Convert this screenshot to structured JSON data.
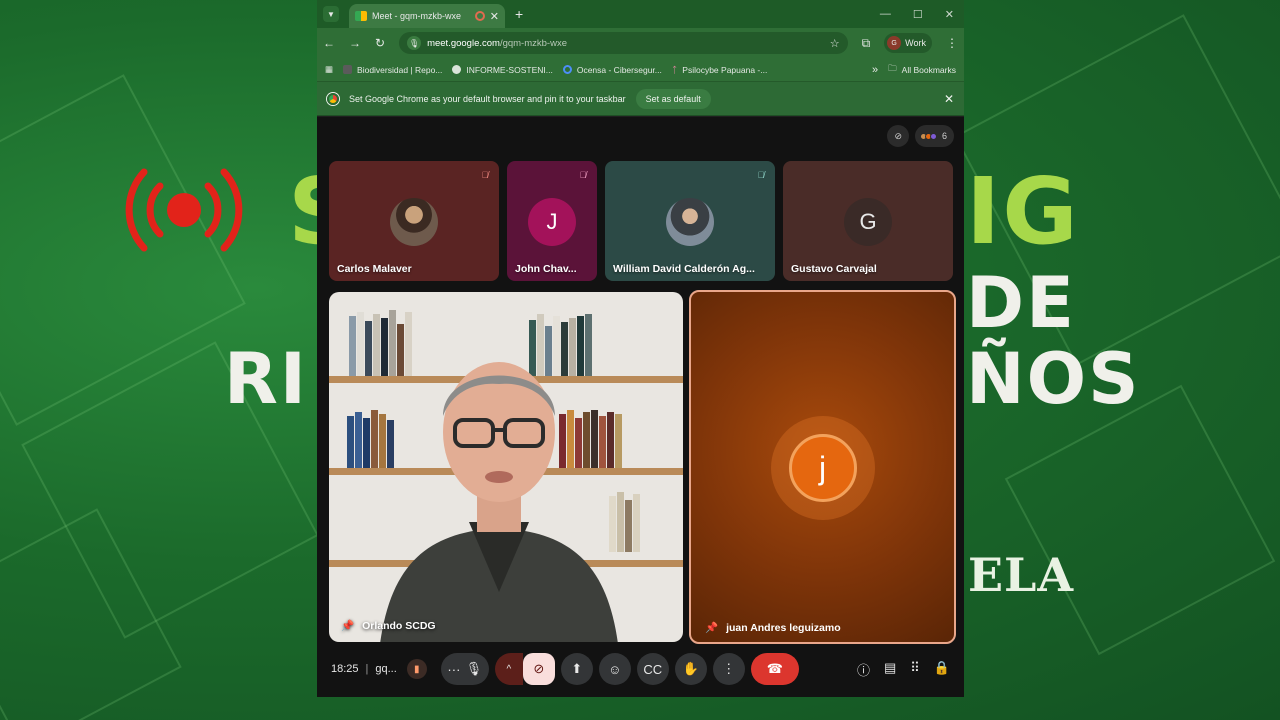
{
  "background": {
    "headline_fragments": [
      "S",
      "IG",
      "DE",
      "RI",
      "ÑOS"
    ],
    "script_text": "ELA"
  },
  "browser": {
    "tab_title": "Meet - gqm-mzkb-wxe",
    "new_tab": "+",
    "url_host": "meet.google.com",
    "url_path": "/gqm-mzkb-wxe",
    "profile_label": "Work",
    "profile_initial": "G",
    "bookmarks": [
      "Biodiversidad | Repo...",
      "INFORME-SOSTENI...",
      "Ocensa - Cibersegur...",
      "Psilocybe Papuana -..."
    ],
    "all_bookmarks": "All Bookmarks",
    "infobar_text": "Set Google Chrome as your default browser and pin it to your taskbar",
    "set_default_label": "Set as default"
  },
  "meet": {
    "participant_count": "6",
    "tiles": [
      {
        "name": "Carlos Malaver",
        "initial": "",
        "muted": true
      },
      {
        "name": "John Chav...",
        "initial": "J",
        "muted": true
      },
      {
        "name": "William David Calderón Ag...",
        "initial": "",
        "muted": true
      },
      {
        "name": "Gustavo Carvajal",
        "initial": "G",
        "muted": false
      }
    ],
    "main_speaker": "Orlando SCDG",
    "side_speaker": "juan Andres leguizamo",
    "side_initial": "j",
    "time": "18:25",
    "meeting_code": "gq..."
  },
  "colors": {
    "tile_carlos": "#5a2423",
    "tile_john": "#5b1339",
    "tile_william": "#2c4a46",
    "tile_gustavo": "#4a2c28",
    "end_call": "#dc362e",
    "side_border": "#e9a68a"
  }
}
